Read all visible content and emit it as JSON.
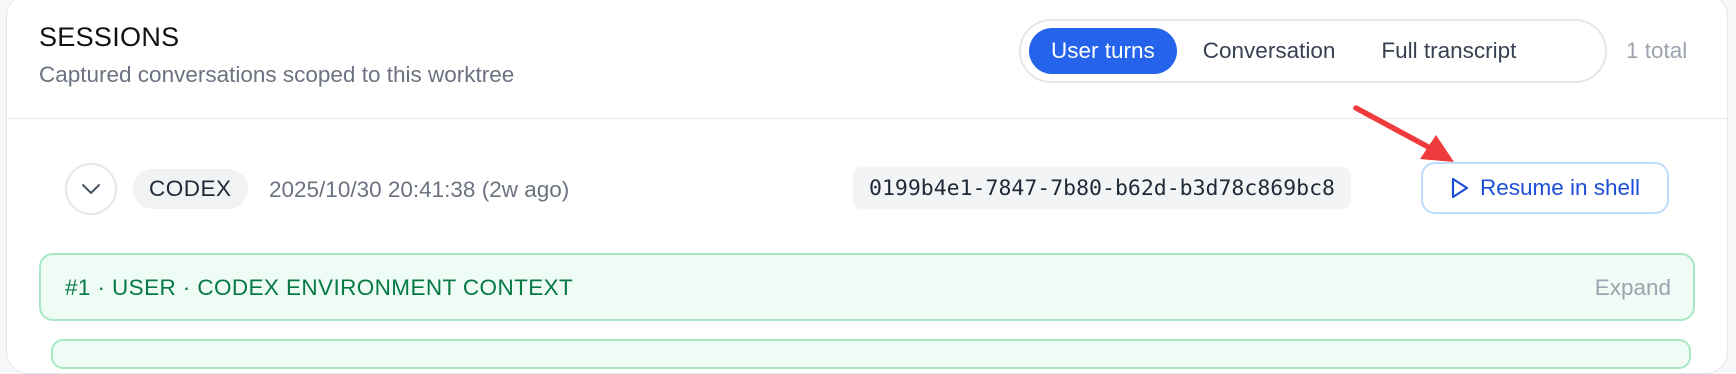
{
  "header": {
    "title": "SESSIONS",
    "subtitle": "Captured conversations scoped to this worktree"
  },
  "view_toggle": {
    "options": [
      "User turns",
      "Conversation",
      "Full transcript"
    ],
    "selected": "User turns"
  },
  "total_label": "1 total",
  "session": {
    "agent": "CODEX",
    "timestamp": "2025/10/30 20:41:38 (2w ago)",
    "id": "0199b4e1-7847-7b80-b62d-b3d78c869bc8",
    "resume_label": "Resume in shell",
    "expand_icon": "chevron-down-icon",
    "resume_icon": "play-icon"
  },
  "turns": [
    {
      "label": "#1 · USER · CODEX ENVIRONMENT CONTEXT",
      "action": "Expand"
    }
  ],
  "colors": {
    "accent": "#2563eb",
    "turn_green": "#067a44",
    "turn_bg": "#effcf5",
    "annotation_arrow": "#ef3b3b"
  }
}
